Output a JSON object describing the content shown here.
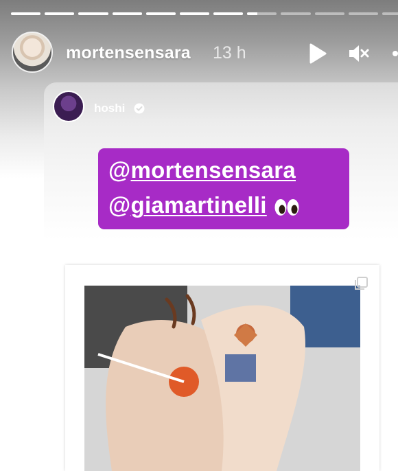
{
  "story": {
    "progress": [
      1,
      1,
      1,
      1,
      1,
      1,
      1,
      0.35,
      0,
      0,
      0,
      0
    ],
    "user": {
      "username": "mortensensara",
      "time": "13 h"
    },
    "controls": {
      "play": "play-icon",
      "mute": "mute-icon",
      "more": "more-icon"
    }
  },
  "shared_post": {
    "username": "hoshi",
    "verified_icon": "verified-badge-icon",
    "sticker": {
      "background": "#a72bc6",
      "mentions": [
        "@mortensensara",
        "@giamartinelli"
      ],
      "emoji": "eyes-emoji"
    },
    "post_image_icon": "multi-post-icon"
  },
  "colors": {
    "sticker": "#a72bc6",
    "text": "#ffffff"
  }
}
